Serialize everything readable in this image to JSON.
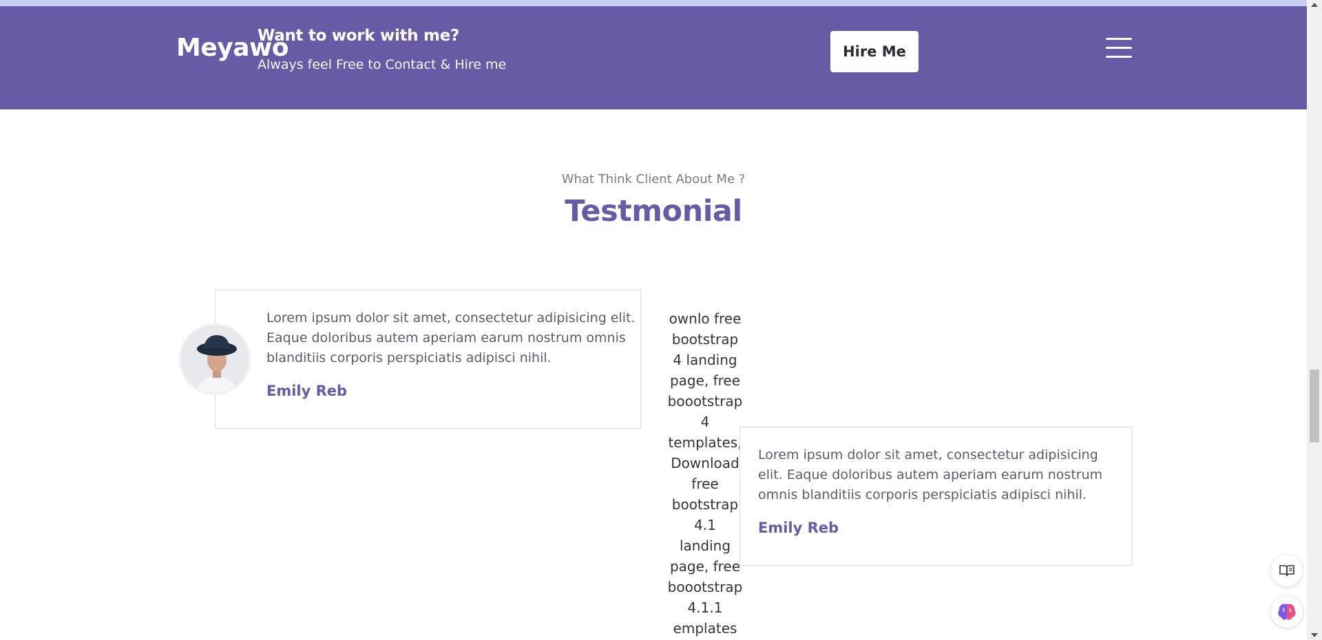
{
  "header": {
    "brand": "Meyawo",
    "cta_title": "Want to work with me?",
    "cta_subtitle": "Always feel Free to Contact & Hire me",
    "hire_button": "Hire Me",
    "background": "#695aa6"
  },
  "testimonial": {
    "subtitle": "What Think Client About Me ?",
    "title": "Testmonial",
    "accent": "#695aa6",
    "cards": [
      {
        "text": "Lorem ipsum dolor sit amet, consectetur adipisicing elit. Eaque doloribus autem aperiam earum nostrum omnis blanditiis corporis perspiciatis adipisci nihil.",
        "name": "Emily Reb",
        "avatar_icon": "user-avatar-photo"
      },
      {
        "text": "Lorem ipsum dolor sit amet, consectetur adipisicing elit. Eaque doloribus autem aperiam earum nostrum omnis blanditiis corporis perspiciatis adipisci nihil.",
        "name": "Emily Reb",
        "avatar_alt": "ownlo free bootstrap 4 landing page, free boootstrap 4 templates, Download free bootstrap 4.1 landing page, free boootstrap 4.1.1 emplates"
      }
    ]
  },
  "icons": {
    "menu": "hamburger-menu-icon",
    "reader": "reader-mode-icon",
    "assistant": "brain-assistant-icon"
  }
}
